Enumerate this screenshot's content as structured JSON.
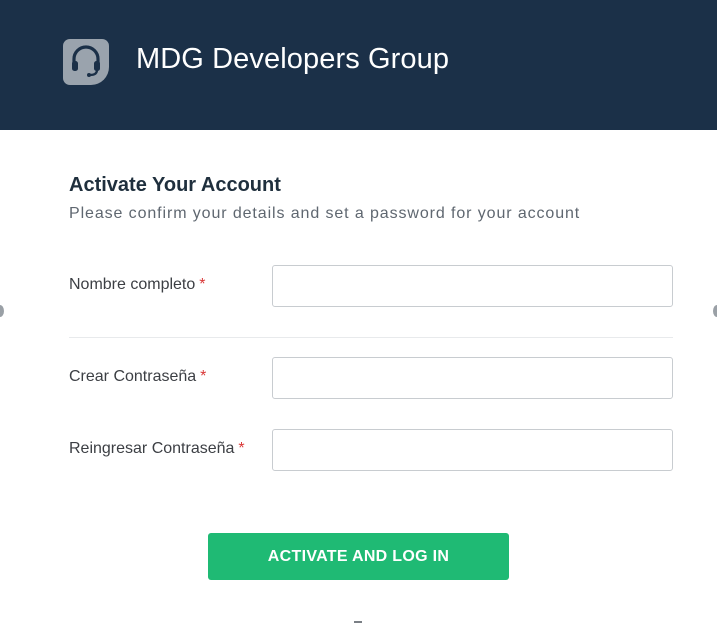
{
  "header": {
    "brand_name": "MDG Developers Group",
    "logo_icon": "headset-icon",
    "background_color": "#1b3048"
  },
  "form": {
    "title": "Activate Your Account",
    "subtitle": "Please confirm your details and set a password for your account",
    "required_marker": "*",
    "fields": [
      {
        "label": "Nombre completo",
        "value": "",
        "placeholder": ""
      },
      {
        "label": "Crear Contraseña",
        "value": "",
        "placeholder": ""
      },
      {
        "label": "Reingresar Contraseña",
        "value": "",
        "placeholder": ""
      }
    ],
    "submit_label": "ACTIVATE AND LOG IN",
    "submit_color": "#1fba74",
    "required_color": "#d93636"
  }
}
